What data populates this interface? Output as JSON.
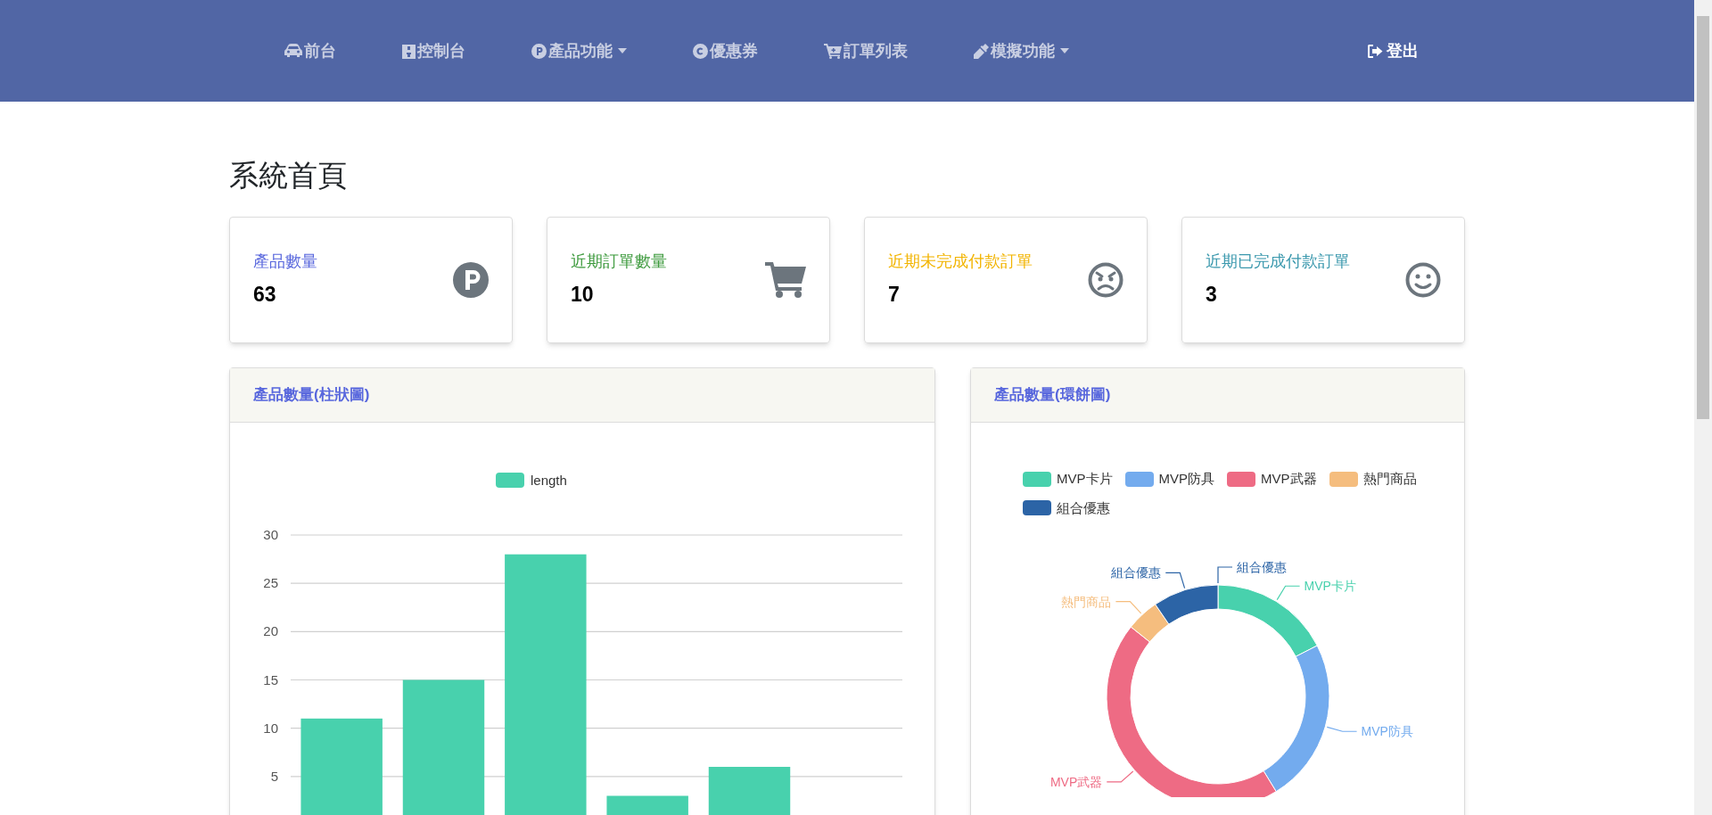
{
  "nav": {
    "items": [
      {
        "label": "前台",
        "dropdown": false
      },
      {
        "label": "控制台",
        "dropdown": false
      },
      {
        "label": "產品功能",
        "dropdown": true
      },
      {
        "label": "優惠券",
        "dropdown": false
      },
      {
        "label": "訂單列表",
        "dropdown": false
      },
      {
        "label": "模擬功能",
        "dropdown": true
      }
    ],
    "logout": "登出"
  },
  "page_title": "系統首頁",
  "stat_cards": [
    {
      "label": "產品數量",
      "value": "63",
      "color": "#5867dd"
    },
    {
      "label": "近期訂單數量",
      "value": "10",
      "color": "#3d9a3d"
    },
    {
      "label": "近期未完成付款訂單",
      "value": "7",
      "color": "#f2b400"
    },
    {
      "label": "近期已完成付款訂單",
      "value": "3",
      "color": "#3a98ad"
    }
  ],
  "bar_panel": {
    "title": "產品數量(柱狀圖)",
    "chart_data": {
      "type": "bar",
      "grid": true,
      "yticks": [
        5,
        10,
        15,
        20,
        25,
        30
      ],
      "ylim": [
        0,
        30
      ],
      "series": [
        {
          "name": "length",
          "color": "#48d1ad",
          "values": [
            11,
            15,
            28,
            3,
            6,
            0
          ]
        }
      ]
    }
  },
  "donut_panel": {
    "title": "產品數量(環餅圖)",
    "legend": [
      {
        "label": "MVP卡片",
        "color": "#48d1ad"
      },
      {
        "label": "MVP防具",
        "color": "#73abee"
      },
      {
        "label": "MVP武器",
        "color": "#ee6b84"
      },
      {
        "label": "熱門商品",
        "color": "#f5bd7e"
      },
      {
        "label": "組合優惠",
        "color": "#2c64a6"
      }
    ],
    "chart_data": {
      "type": "donut",
      "categories": [
        "MVP卡片",
        "MVP防具",
        "MVP武器",
        "熱門商品",
        "組合優惠",
        "組合優惠"
      ],
      "series": [
        {
          "values": [
            17.46,
            23.81,
            44.45,
            4.76,
            9.52,
            0
          ]
        }
      ],
      "colors": [
        "#48d1ad",
        "#73abee",
        "#ee6b84",
        "#f5bd7e",
        "#2c64a6",
        "#2c64a6"
      ]
    }
  }
}
